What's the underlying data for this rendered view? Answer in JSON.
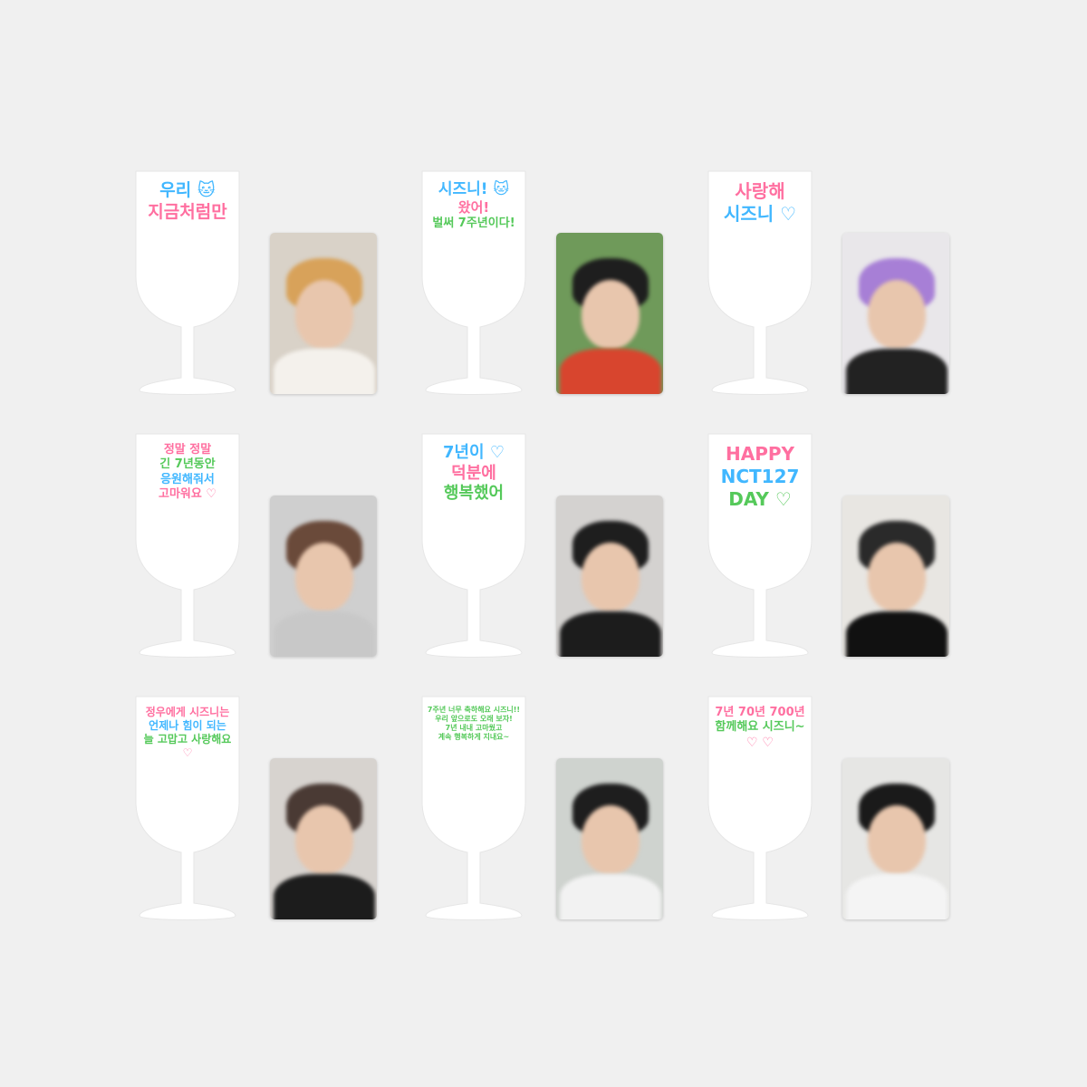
{
  "colors": {
    "background": "#f0f0f0",
    "glass": "#ffffff",
    "pink": "#ff6fa0",
    "green": "#55c95a",
    "blue": "#41b7ff",
    "yellow": "#ffd24a",
    "purple": "#b07cff"
  },
  "items": [
    {
      "glass_lines": [
        {
          "text": "우리 🐱",
          "color": "#41b7ff"
        },
        {
          "text": "지금처럼만",
          "color": "#ff6fa0"
        }
      ],
      "photocard": {
        "bg": "#d9d2c8",
        "hair": "#d8a25a",
        "body": "#f4f1ec"
      }
    },
    {
      "glass_lines": [
        {
          "text": "시즈니! 🐱",
          "color": "#41b7ff"
        },
        {
          "text": "왔어!",
          "color": "#ff6fa0"
        },
        {
          "text": "벌써 7주년이다!",
          "color": "#55c95a"
        }
      ],
      "photocard": {
        "bg": "#6f9a5a",
        "hair": "#1e1e1e",
        "body": "#d8452e"
      }
    },
    {
      "glass_lines": [
        {
          "text": "사랑해",
          "color": "#ff6fa0"
        },
        {
          "text": "시즈니 ♡",
          "color": "#41b7ff"
        }
      ],
      "photocard": {
        "bg": "#e9e7ea",
        "hair": "#a77fd6",
        "body": "#222222"
      }
    },
    {
      "glass_lines": [
        {
          "text": "정말 정말",
          "color": "#ff6fa0"
        },
        {
          "text": "긴 7년동안",
          "color": "#55c95a"
        },
        {
          "text": "응원해줘서",
          "color": "#41b7ff"
        },
        {
          "text": "고마워요 ♡",
          "color": "#ff6fa0"
        }
      ],
      "photocard": {
        "bg": "#cfcfcf",
        "hair": "#6a4a3a",
        "body": "#c8c8c8"
      }
    },
    {
      "glass_lines": [
        {
          "text": "7년이 ♡",
          "color": "#41b7ff"
        },
        {
          "text": "덕분에",
          "color": "#ff6fa0"
        },
        {
          "text": "행복했어",
          "color": "#55c95a"
        }
      ],
      "photocard": {
        "bg": "#d4d2d0",
        "hair": "#1e1e1e",
        "body": "#1c1c1c"
      }
    },
    {
      "glass_lines": [
        {
          "text": "HAPPY",
          "color": "#ff6fa0"
        },
        {
          "text": "NCT127",
          "color": "#41b7ff"
        },
        {
          "text": "DAY ♡",
          "color": "#55c95a"
        }
      ],
      "photocard": {
        "bg": "#e8e6e2",
        "hair": "#2a2a2a",
        "body": "#111111"
      }
    },
    {
      "glass_lines": [
        {
          "text": "정우에게 시즈니는",
          "color": "#ff6fa0"
        },
        {
          "text": "언제나 힘이 되는",
          "color": "#41b7ff"
        },
        {
          "text": "늘 고맙고 사랑해요",
          "color": "#55c95a"
        },
        {
          "text": "♡",
          "color": "#ff6fa0"
        }
      ],
      "photocard": {
        "bg": "#d7d3cf",
        "hair": "#4a3a34",
        "body": "#1c1c1c"
      }
    },
    {
      "glass_lines": [
        {
          "text": "7주년 너무 축하해요 시즈니!!",
          "color": "#55c95a"
        },
        {
          "text": "우리 앞으로도 오래 보자!",
          "color": "#55c95a"
        },
        {
          "text": "7년 내내 고마웠고",
          "color": "#55c95a"
        },
        {
          "text": "계속 행복하게 지내요~",
          "color": "#55c95a"
        }
      ],
      "photocard": {
        "bg": "#cfd3cf",
        "hair": "#1e1e1e",
        "body": "#f2f2f2"
      }
    },
    {
      "glass_lines": [
        {
          "text": "7년 70년 700년",
          "color": "#ff6fa0"
        },
        {
          "text": "함께해요 시즈니~",
          "color": "#55c95a"
        },
        {
          "text": "♡ ♡",
          "color": "#ff6fa0"
        }
      ],
      "photocard": {
        "bg": "#e6e6e4",
        "hair": "#1a1a1a",
        "body": "#f4f4f4"
      }
    }
  ]
}
